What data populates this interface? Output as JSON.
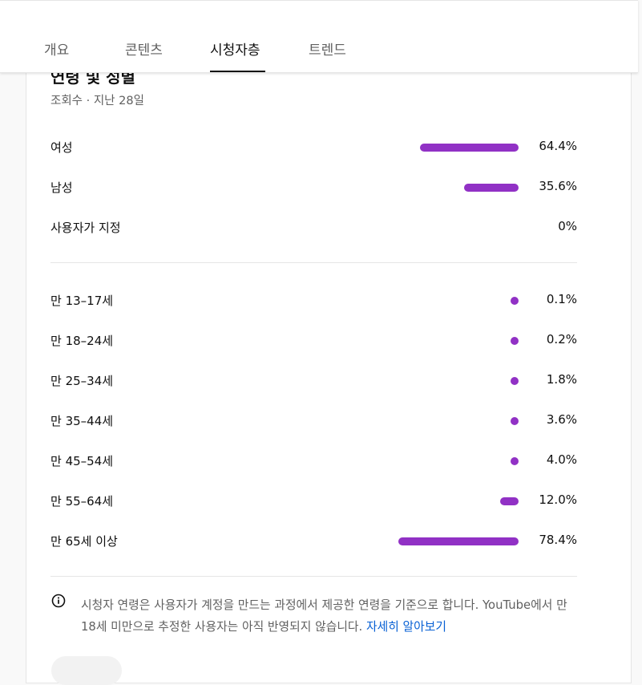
{
  "tabs": [
    {
      "label": "개요"
    },
    {
      "label": "콘텐츠"
    },
    {
      "label": "시청자층"
    },
    {
      "label": "트렌드"
    }
  ],
  "active_tab": "시청자층",
  "section": {
    "title": "연령 및 성별",
    "subtitle": "조회수 · 지난 28일"
  },
  "gender": [
    {
      "label": "여성",
      "value": "64.4%",
      "fraction": 0.644
    },
    {
      "label": "남성",
      "value": "35.6%",
      "fraction": 0.356
    },
    {
      "label": "사용자가 지정",
      "value": "0%",
      "fraction": 0
    }
  ],
  "age": [
    {
      "label": "만 13–17세",
      "value": "0.1%",
      "fraction": 0.001
    },
    {
      "label": "만 18–24세",
      "value": "0.2%",
      "fraction": 0.002
    },
    {
      "label": "만 25–34세",
      "value": "1.8%",
      "fraction": 0.018
    },
    {
      "label": "만 35–44세",
      "value": "3.6%",
      "fraction": 0.036
    },
    {
      "label": "만 45–54세",
      "value": "4.0%",
      "fraction": 0.04
    },
    {
      "label": "만 55–64세",
      "value": "12.0%",
      "fraction": 0.12
    },
    {
      "label": "만 65세 이상",
      "value": "78.4%",
      "fraction": 0.784
    }
  ],
  "note": {
    "text": "시청자 연령은 사용자가 계정을 만드는 과정에서 제공한 연령을 기준으로 합니다. YouTube에서 만 18세 미만으로 추정한 사용자는 아직 반영되지 않습니다.",
    "link": "자세히 알아보기"
  },
  "colors": {
    "bar": "#9131c5",
    "link": "#065fd4"
  },
  "icons": {
    "info": "info-icon"
  }
}
